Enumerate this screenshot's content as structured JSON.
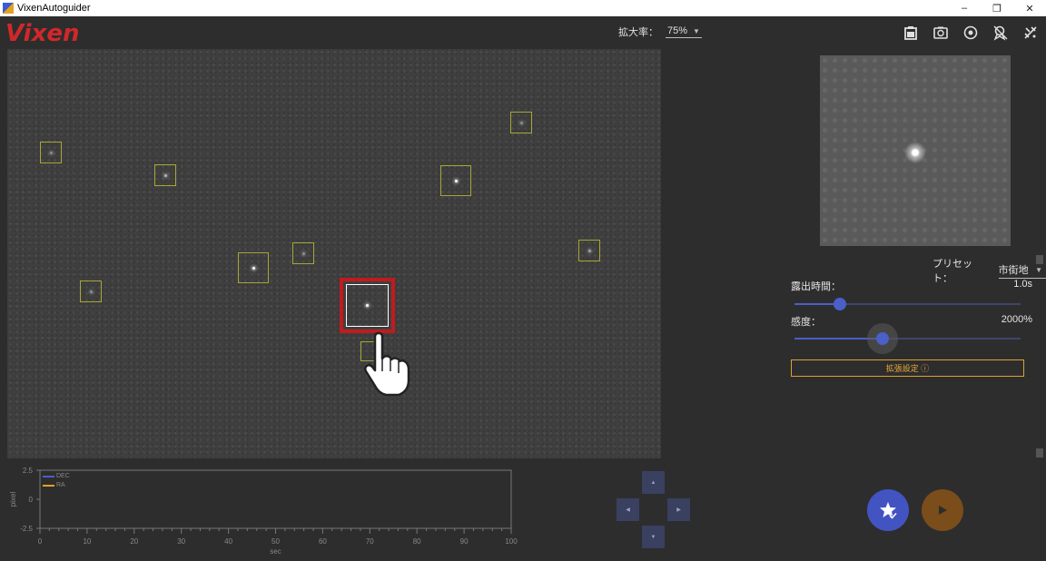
{
  "window": {
    "title": "VixenAutoguider",
    "controls": [
      "–",
      "❐",
      "✕"
    ]
  },
  "header": {
    "logo": "Vixen",
    "zoom_label": "拡大率：",
    "zoom_value": "75%",
    "toolbar_icons": [
      "clipboard-icon",
      "camera-rotate-icon",
      "target-icon",
      "calibrate-icon",
      "no-guide-icon"
    ]
  },
  "image": {
    "star_count_boxes": 11
  },
  "right_panel": {
    "preset_label": "プリセット：",
    "preset_value": "市街地",
    "exposure_label": "露出時間：",
    "exposure_value": "1.0s",
    "exposure_fraction": 0.2,
    "gain_label": "感度：",
    "gain_value": "2000%",
    "gain_fraction": 0.39,
    "advanced_button": "拡張設定 ⓘ"
  },
  "graph": {
    "legend": [
      {
        "name": "DEC",
        "color": "#4a5fc7"
      },
      {
        "name": "RA",
        "color": "#e8a020"
      }
    ],
    "y_ticks": [
      "2.5",
      "0",
      "-2.5"
    ],
    "x_ticks": [
      "0",
      "10",
      "20",
      "30",
      "40",
      "50",
      "60",
      "70",
      "80",
      "90",
      "100"
    ],
    "x_label": "sec",
    "y_label": "pixel"
  },
  "dpad": {
    "up": "▲",
    "down": "▼",
    "left": "◀",
    "right": "▶"
  },
  "colors": {
    "accent_blue": "#4254c2",
    "accent_orange": "#e0a030",
    "brand_red": "#d0282a",
    "selection_red": "#c01b1e"
  }
}
